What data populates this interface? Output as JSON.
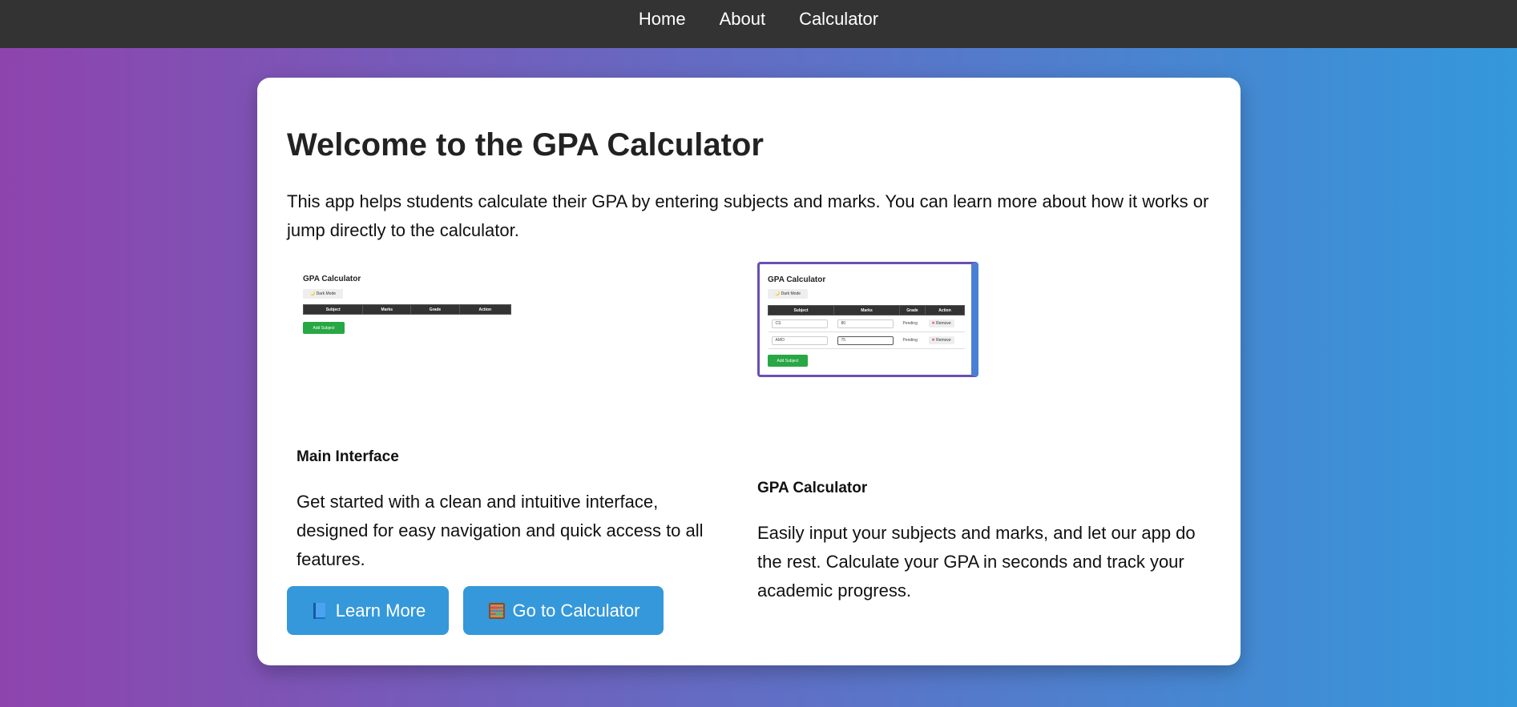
{
  "nav": {
    "items": [
      {
        "label": "Home"
      },
      {
        "label": "About"
      },
      {
        "label": "Calculator"
      }
    ]
  },
  "main": {
    "title": "Welcome to the GPA Calculator",
    "intro": "This app helps students calculate their GPA by entering subjects and marks. You can learn more about how it works or jump directly to the calculator."
  },
  "features": [
    {
      "screenshot": {
        "title": "GPA Calculator",
        "dark_mode_label": "🌙 Dark Mode",
        "columns": [
          "Subject",
          "Marks",
          "Grade",
          "Action"
        ],
        "rows": [],
        "add_label": "Add Subject"
      },
      "heading": "Main Interface",
      "text": "Get started with a clean and intuitive interface, designed for easy navigation and quick access to all features."
    },
    {
      "screenshot": {
        "title": "GPA Calculator",
        "dark_mode_label": "🌙 Dark Mode",
        "columns": [
          "Subject",
          "Marks",
          "Grade",
          "Action"
        ],
        "rows": [
          {
            "subject": "CS",
            "marks": "80",
            "grade": "Pending",
            "action": "Remove"
          },
          {
            "subject": "AMO",
            "marks": "75",
            "grade": "Pending",
            "action": "Remove"
          }
        ],
        "add_label": "Add Subject"
      },
      "heading": "GPA Calculator",
      "text": "Easily input your subjects and marks, and let our app do the rest. Calculate your GPA in seconds and track your academic progress."
    }
  ],
  "buttons": {
    "learn_more": {
      "label": "Learn More",
      "icon": "blue-book-icon"
    },
    "go_calculator": {
      "label": "Go to Calculator",
      "icon": "abacus-icon"
    }
  },
  "colors": {
    "navbar": "#333333",
    "gradient_start": "#8e44ad",
    "gradient_end": "#3498db",
    "button": "#3498db",
    "add_button": "#28a745"
  }
}
